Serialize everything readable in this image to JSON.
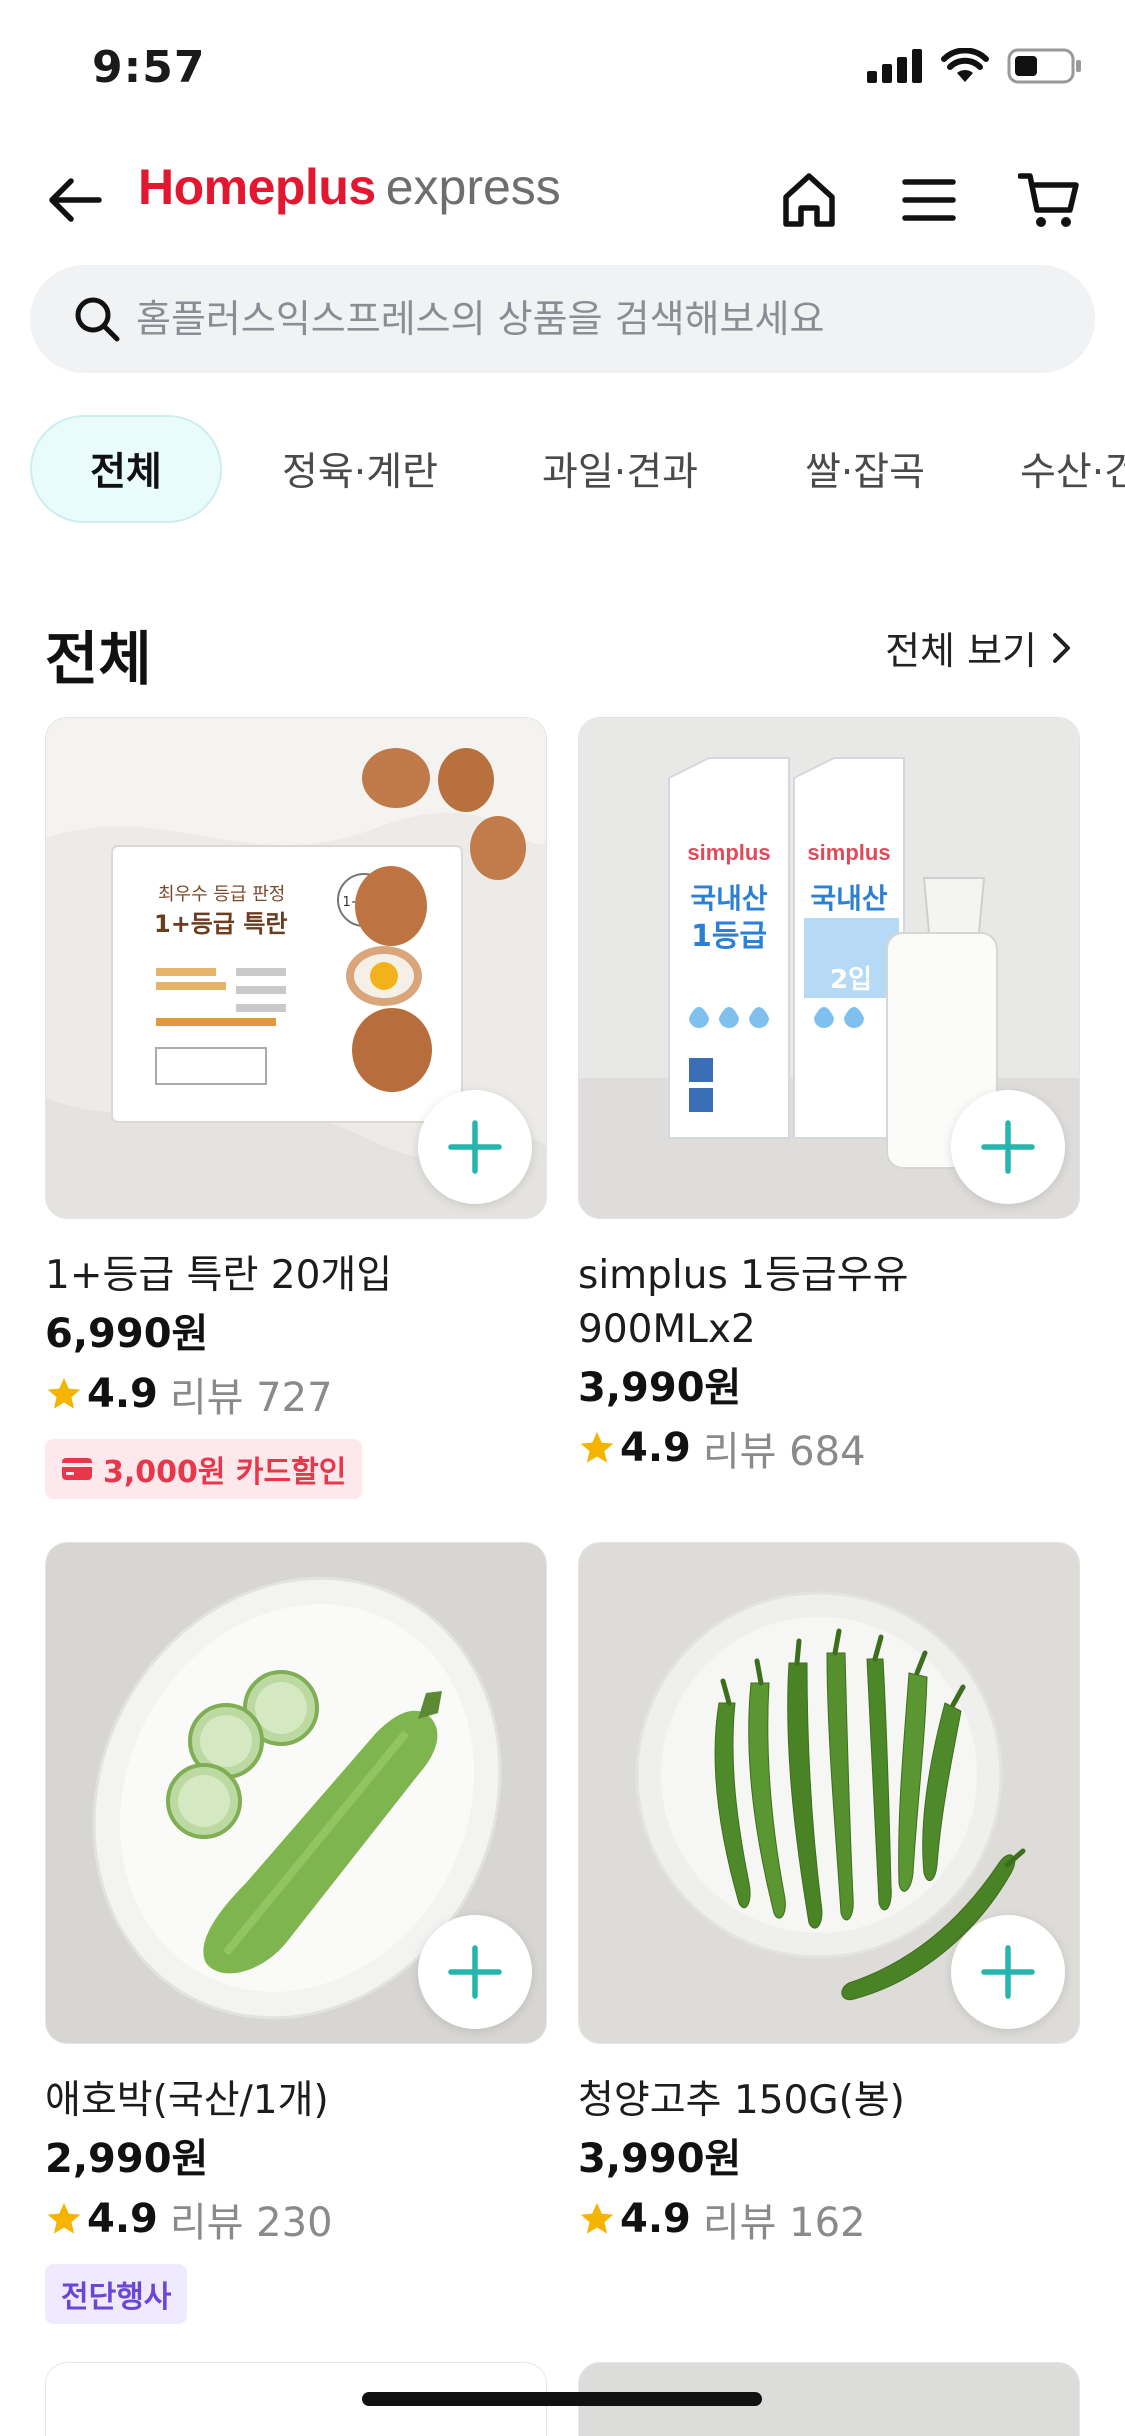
{
  "status_bar": {
    "time": "9:57"
  },
  "header": {
    "logo_brand": "Homeplus",
    "logo_sub": "express"
  },
  "search": {
    "placeholder": "홈플러스익스프레스의 상품을 검색해보세요"
  },
  "categories": [
    {
      "label": "전체",
      "active": true
    },
    {
      "label": "정육·계란",
      "active": false
    },
    {
      "label": "과일·견과",
      "active": false
    },
    {
      "label": "쌀·잡곡",
      "active": false
    },
    {
      "label": "수산·건어",
      "active": false
    }
  ],
  "section": {
    "title": "전체",
    "view_all_label": "전체 보기"
  },
  "products": [
    {
      "name": "1+등급 특란 20개입",
      "price": "6,990원",
      "rating": "4.9",
      "review_label": "리뷰 727",
      "badge": "3,000원 카드할인",
      "box_title_line1": "최우수 등급 판정",
      "box_title_line2": "1+등급 특란",
      "box_badge": "1+등급"
    },
    {
      "name": "simplus 1등급우유 900MLx2",
      "price": "3,990원",
      "rating": "4.9",
      "review_label": "리뷰 684",
      "carton_brand": "simplus",
      "carton_line1": "국내산",
      "carton_line2": "1등급",
      "carton_pack": "2입"
    },
    {
      "name": "애호박(국산/1개)",
      "price": "2,990원",
      "rating": "4.9",
      "review_label": "리뷰 230",
      "badge": "전단행사"
    },
    {
      "name": "청양고추 150G(봉)",
      "price": "3,990원",
      "rating": "4.9",
      "review_label": "리뷰 162"
    }
  ],
  "colors": {
    "brand_red": "#e3172f",
    "accent_teal": "#26b5ad",
    "star": "#f5b400"
  }
}
